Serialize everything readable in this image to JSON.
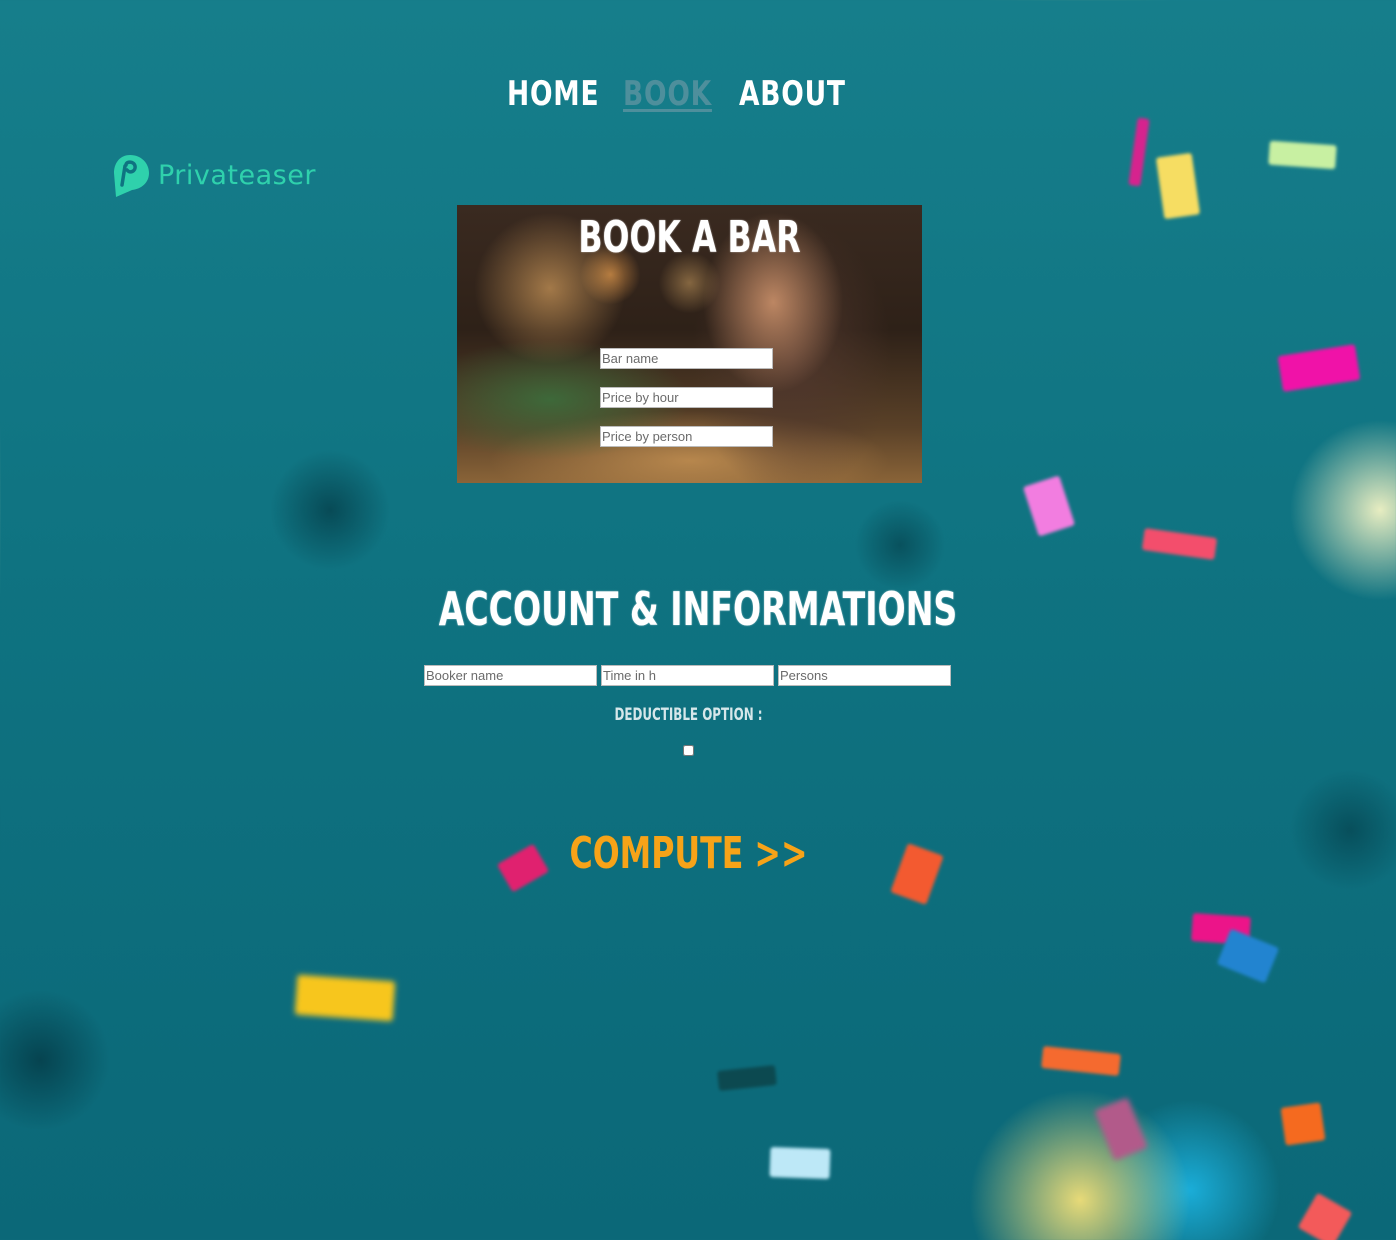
{
  "nav": {
    "items": [
      {
        "label": "HOME",
        "active": false
      },
      {
        "label": "BOOK",
        "active": true
      },
      {
        "label": "ABOUT",
        "active": false
      }
    ]
  },
  "logo": {
    "text": "Privateaser",
    "icon": "privateaser-logo-icon",
    "color": "#2fd1ac"
  },
  "book_card": {
    "title": "BOOK A BAR",
    "fields": [
      {
        "placeholder": "Bar name",
        "value": ""
      },
      {
        "placeholder": "Price by hour",
        "value": ""
      },
      {
        "placeholder": "Price by person",
        "value": ""
      }
    ]
  },
  "account": {
    "title": "ACCOUNT & INFORMATIONS",
    "fields": [
      {
        "placeholder": "Booker name",
        "value": ""
      },
      {
        "placeholder": "Time in h",
        "value": ""
      },
      {
        "placeholder": "Persons",
        "value": ""
      }
    ],
    "deductible_label": "DEDUCTIBLE OPTION :",
    "deductible_checked": false
  },
  "compute": {
    "label": "COMPUTE >>",
    "color": "#f7a318"
  },
  "colors": {
    "background": "#0f7381",
    "nav_active": "#4e8f9c",
    "text": "#ffffff"
  }
}
